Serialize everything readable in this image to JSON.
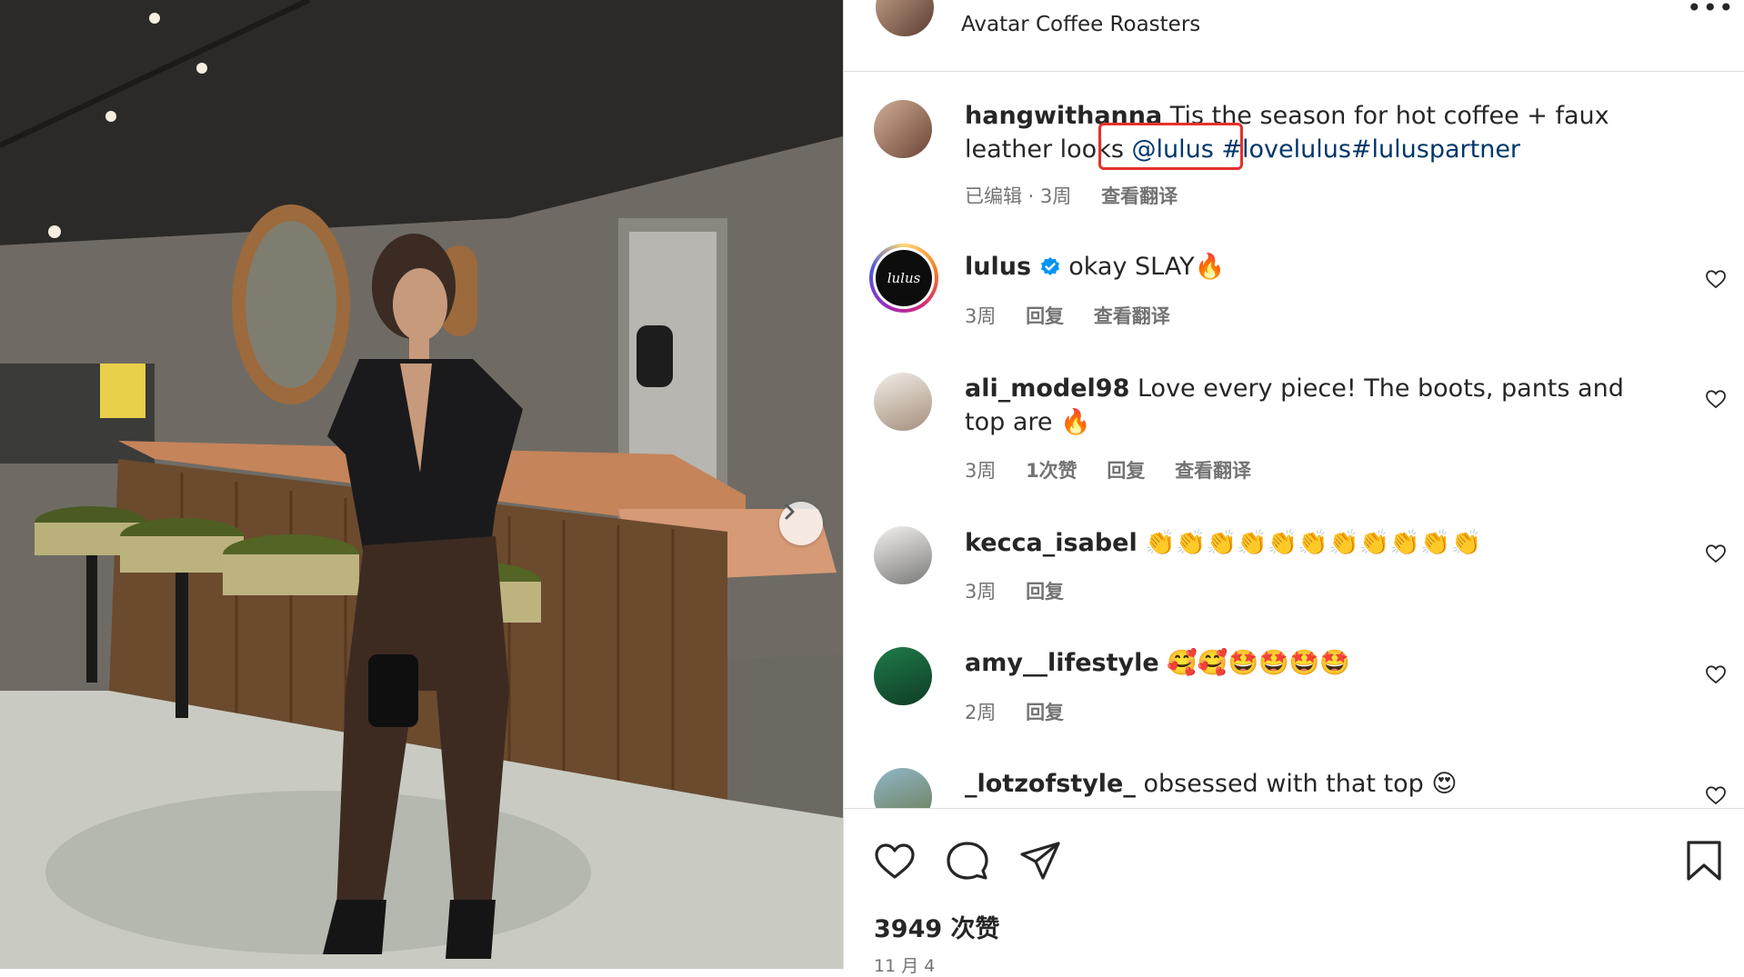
{
  "post": {
    "location": "Avatar Coffee Roasters",
    "more_icon": "•••",
    "caption": {
      "username": "hangwithanna",
      "text": "Tis the season for hot coffee + faux leather looks",
      "mention": "@lulus",
      "hashtag1": "#lovelulus",
      "hashtag2": "#luluspartner",
      "meta_edited": "已编辑 · 3周",
      "meta_translate": "查看翻译"
    },
    "likes_text": "3949 次赞",
    "date_text": "11 月 4"
  },
  "comments": [
    {
      "username": "lulus",
      "text": "okay SLAY🔥",
      "time": "3周",
      "reply": "回复",
      "translate": "查看翻译",
      "verified": true
    },
    {
      "username": "ali_model98",
      "text": "Love every piece! The boots, pants and top are 🔥",
      "time": "3周",
      "likes": "1次赞",
      "reply": "回复",
      "translate": "查看翻译"
    },
    {
      "username": "kecca_isabel",
      "text": "👏👏👏👏👏👏👏👏👏👏👏",
      "time": "3周",
      "reply": "回复"
    },
    {
      "username": "amy__lifestyle",
      "text": "🥰🥰🤩🤩🤩🤩",
      "time": "2周",
      "reply": "回复"
    },
    {
      "username": "_lotzofstyle_",
      "text": "obsessed with that top 😍"
    }
  ],
  "icons": {
    "like": "heart-icon",
    "comment": "comment-icon",
    "share": "share-icon",
    "save": "bookmark-icon",
    "carousel": "chevron-right-icon",
    "verified": "verified-badge-icon"
  },
  "colors": {
    "link": "#00376b",
    "highlight": "#e5312a",
    "verified": "#0095f6",
    "meta": "#737373"
  }
}
